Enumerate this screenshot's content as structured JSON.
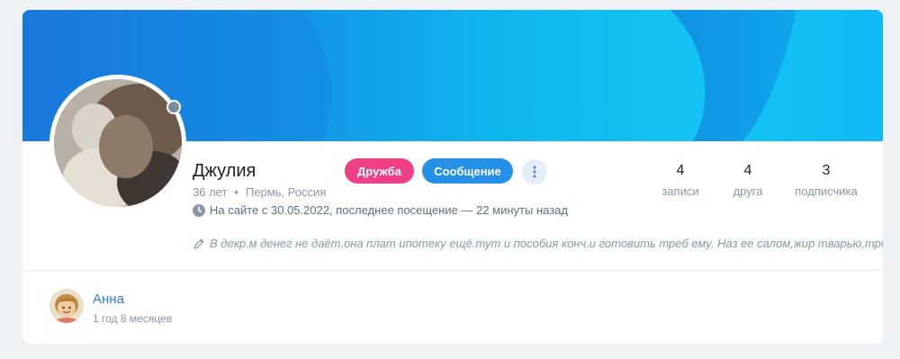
{
  "profile": {
    "name": "Джулия",
    "age": "36 лет",
    "separator": "•",
    "location": "Пермь, Россия",
    "last_seen": "На сайте с 30.05.2022, последнее посещение — 22 минуты назад",
    "bio": "В декр.м денег не даёт.она плат ипотеку ещё.тут и пособия конч.и готовить треб ему. Наз ее салом,жир тварью,треб ху",
    "online_status_color": "#7c8c98"
  },
  "actions": {
    "friend_label": "Дружба",
    "message_label": "Сообщение",
    "friend_color": "#ef3f86",
    "message_color": "#2490e6"
  },
  "stats": [
    {
      "value": "4",
      "label": "записи"
    },
    {
      "value": "4",
      "label": "друга"
    },
    {
      "value": "3",
      "label": "подписчика"
    }
  ],
  "friend": {
    "name": "Анна",
    "duration": "1 год 8 месяцев"
  },
  "icons": {
    "clock": "clock-icon",
    "pencil": "pencil-icon",
    "more": "more-vertical-icon"
  }
}
